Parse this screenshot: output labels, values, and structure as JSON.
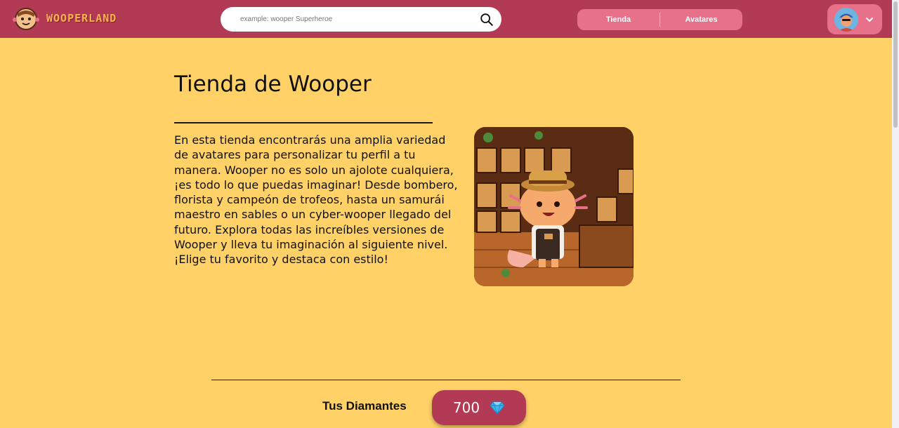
{
  "header": {
    "brand": "WOOPERLAND",
    "search_placeholder": "example: wooper Superheroe",
    "nav": [
      {
        "label": "Tienda"
      },
      {
        "label": "Avatares"
      }
    ]
  },
  "main": {
    "title": "Tienda de Wooper",
    "description": "En esta tienda encontrarás una amplia variedad de avatares para personalizar tu perfil a tu manera. Wooper no es solo un ajolote cualquiera, ¡es todo lo que puedas imaginar! Desde bombero, florista y campeón de trofeos, hasta un samurái maestro en sables o un cyber-wooper llegado del futuro. Explora todas las increíbles versiones de Wooper y lleva tu imaginación al siguiente nivel. ¡Elige tu favorito y destaca con estilo!"
  },
  "diamonds": {
    "label": "Tus Diamantes",
    "value": "700"
  },
  "icons": {
    "search": "search-icon",
    "chevron": "chevron-down-icon",
    "gem": "diamond-icon"
  },
  "colors": {
    "header": "#b23a55",
    "nav_pill": "#e8718a",
    "background": "#ffd167",
    "brand_text": "#ffb347",
    "gem": "#3fb7ee"
  }
}
